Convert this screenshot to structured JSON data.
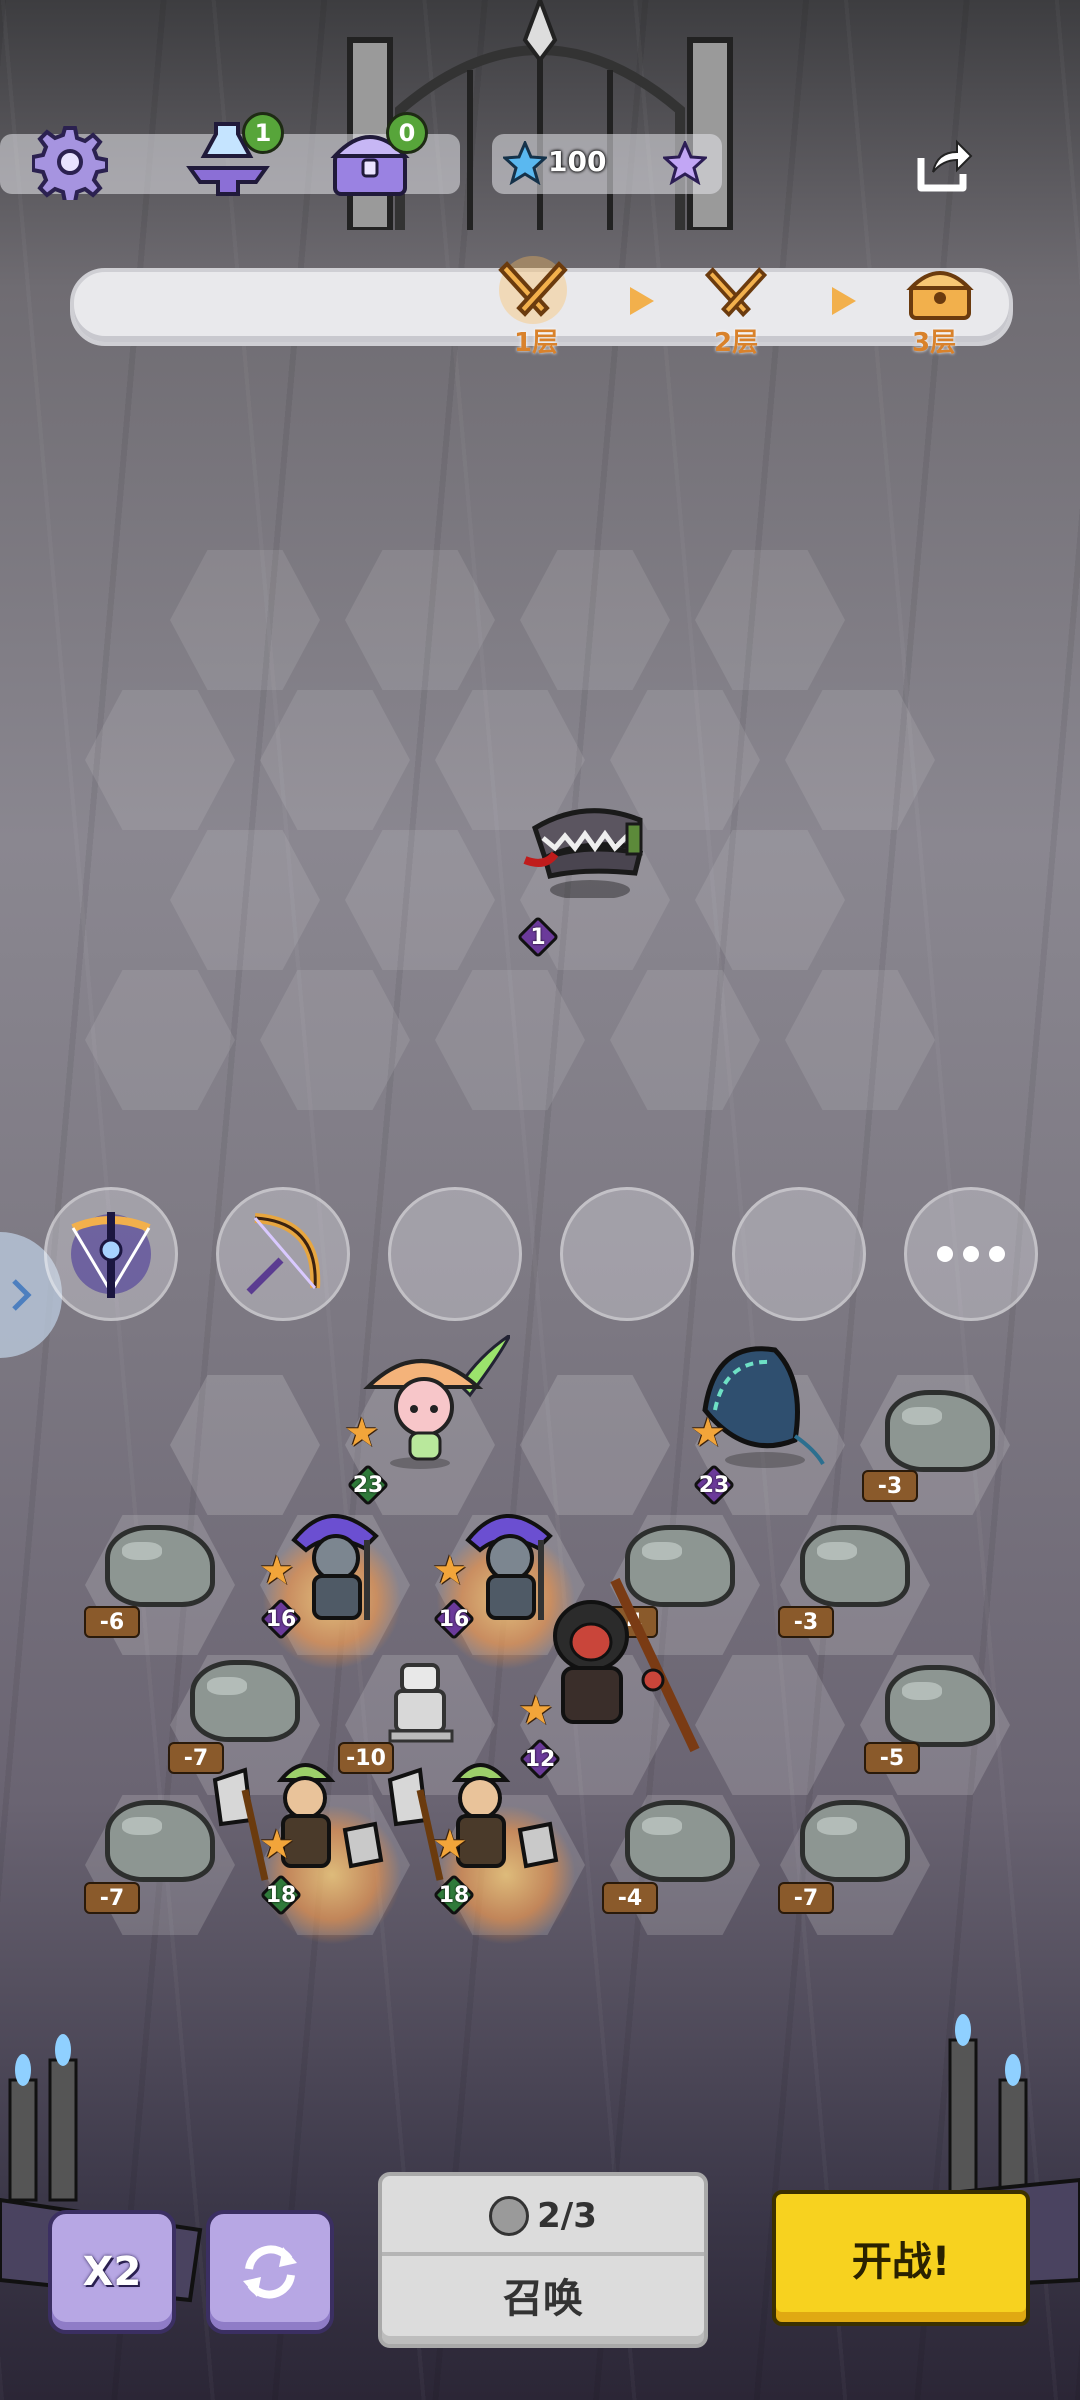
{
  "hud": {
    "potion_count": "1",
    "chest_count": "0",
    "star_count": "100"
  },
  "progress": {
    "floors": [
      "1层",
      "2层",
      "3层"
    ],
    "current_floor": "1层"
  },
  "enemy": {
    "name_icon": "bear-trap-icon",
    "level": "1"
  },
  "items": [
    "magic-crossbow-icon",
    "golden-bow-icon",
    "",
    "",
    ""
  ],
  "units": [
    {
      "icon": "mushroom-fairy-icon",
      "level": "23"
    },
    {
      "icon": "blue-hood-icon",
      "level": "23"
    },
    {
      "icon": "purple-mage-icon",
      "level": "16"
    },
    {
      "icon": "purple-mage-icon",
      "level": "16"
    },
    {
      "icon": "monkey-warrior-icon",
      "level": "12"
    },
    {
      "icon": "axe-soldier-icon",
      "level": "18"
    },
    {
      "icon": "axe-soldier-icon",
      "level": "18"
    }
  ],
  "rocks": [
    "-3",
    "-6",
    "-4",
    "-3",
    "-7",
    "-10",
    "-5",
    "-7",
    "-4",
    "-7"
  ],
  "buttons": {
    "speed": "X2",
    "summon_cost": "2/3",
    "summon_label": "召唤",
    "fight_label": "开战!"
  },
  "colors": {
    "fight_button": "#f7d21f",
    "square_button": "#b7a7e4",
    "level_green": "#2f7a3a",
    "level_purple": "#6b3a9a"
  }
}
